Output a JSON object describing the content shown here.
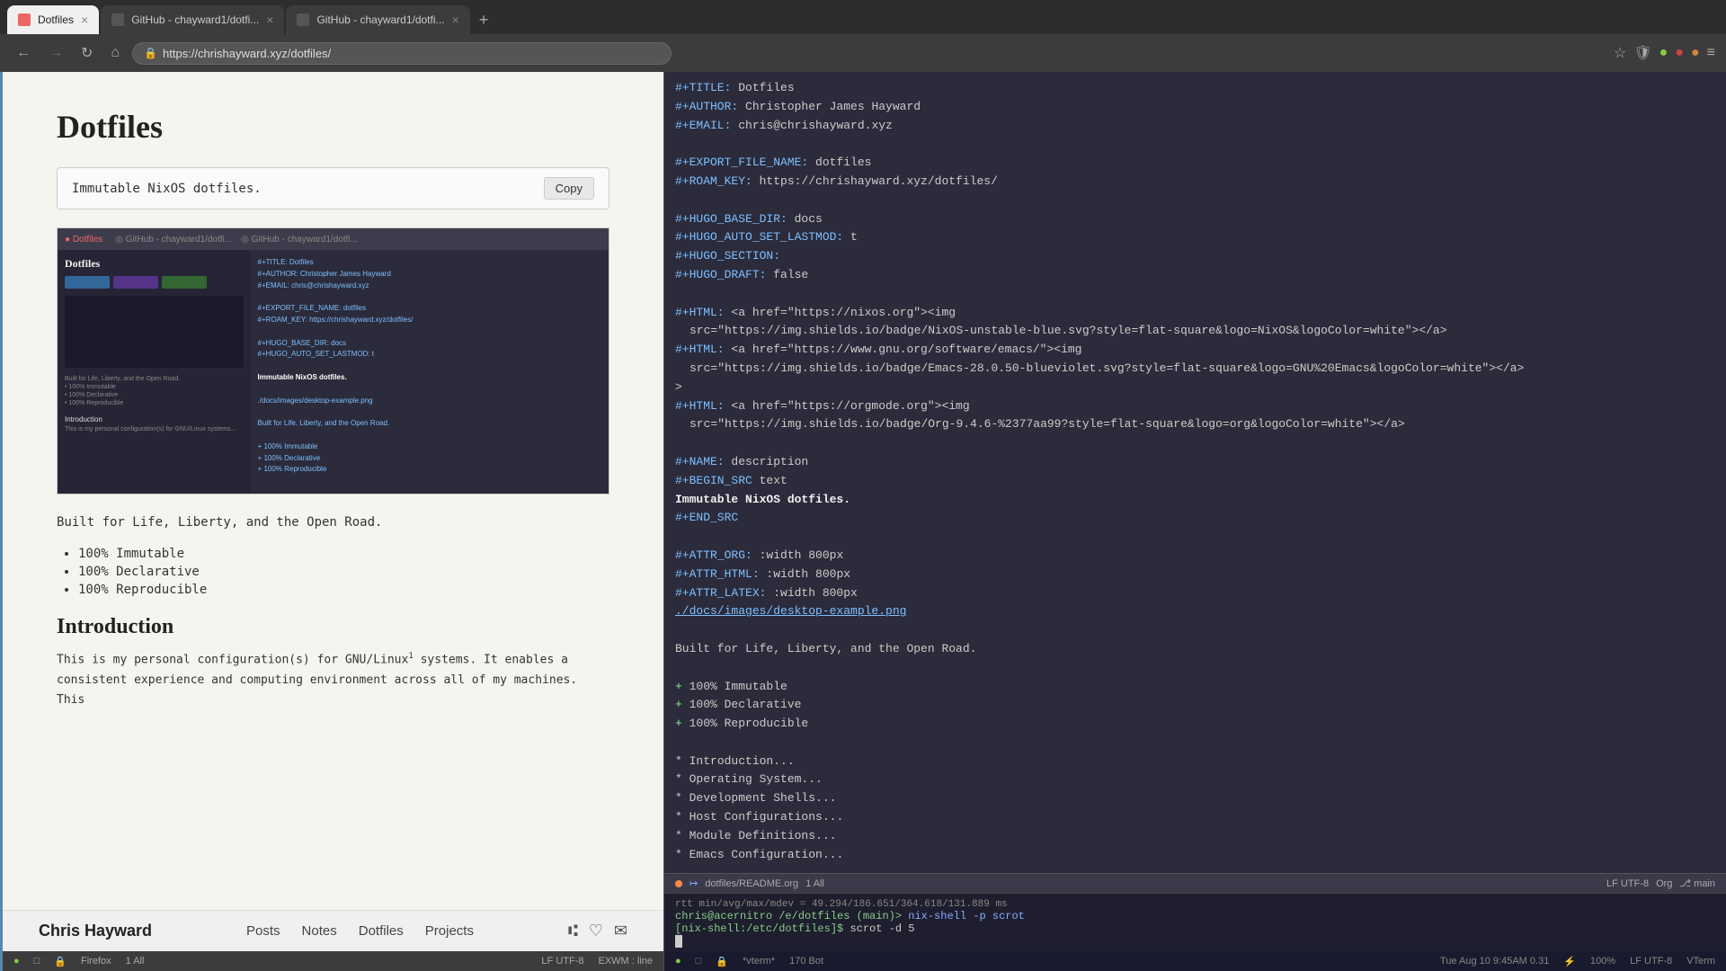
{
  "browser": {
    "tabs": [
      {
        "id": "tab1",
        "title": "Dotfiles",
        "favicon": "🦊",
        "active": true
      },
      {
        "id": "tab2",
        "title": "GitHub - chayward1/dotfi...",
        "favicon": "🐙",
        "active": false
      },
      {
        "id": "tab3",
        "title": "GitHub - chayward1/dotfi...",
        "favicon": "🐙",
        "active": false
      }
    ],
    "url": "https://chrishayward.xyz/dotfiles/",
    "nav_buttons": [
      "←",
      "→",
      "↻",
      "🏠"
    ]
  },
  "website": {
    "title": "Dotfiles",
    "description": "Immutable NixOS dotfiles.",
    "copy_label": "Copy",
    "body_text": "Built for Life, Liberty, and the Open Road.",
    "bullets": [
      "100% Immutable",
      "100% Declarative",
      "100% Reproducible"
    ],
    "intro_heading": "Introduction",
    "intro_text": "This is my personal configuration(s) for GNU/Linux",
    "intro_text2": " systems. It enables a consistent experience and computing environment across all of my machines. This"
  },
  "footer": {
    "name": "Chris Hayward",
    "nav_items": [
      "Posts",
      "Notes",
      "Dotfiles",
      "Projects"
    ]
  },
  "status_bar_browser": {
    "encoding": "LF UTF-8",
    "mode": "EXWM : line",
    "left_items": [
      "●",
      "□",
      "🔒",
      "Firefox",
      "1 All"
    ]
  },
  "editor": {
    "lines": [
      {
        "type": "keyword",
        "key": "#+TITLE:",
        "value": " Dotfiles"
      },
      {
        "type": "keyword",
        "key": "#+AUTHOR:",
        "value": " Christopher James Hayward"
      },
      {
        "type": "keyword",
        "key": "#+EMAIL:",
        "value": " chris@chrishayward.xyz"
      },
      {
        "type": "blank"
      },
      {
        "type": "keyword",
        "key": "#+EXPORT_FILE_NAME:",
        "value": " dotfiles"
      },
      {
        "type": "keyword",
        "key": "#+ROAM_KEY:",
        "value": " https://chrishayward.xyz/dotfiles/"
      },
      {
        "type": "blank"
      },
      {
        "type": "keyword",
        "key": "#+HUGO_BASE_DIR:",
        "value": " docs"
      },
      {
        "type": "keyword",
        "key": "#+HUGO_AUTO_SET_LASTMOD:",
        "value": " t"
      },
      {
        "type": "keyword",
        "key": "#+HUGO_SECTION:",
        "value": ""
      },
      {
        "type": "keyword",
        "key": "#+HUGO_DRAFT:",
        "value": " false"
      },
      {
        "type": "blank"
      },
      {
        "type": "html",
        "content": "#+HTML: <a href=\"https://nixos.org\"><img"
      },
      {
        "type": "html",
        "content": "src=\"https://img.shields.io/badge/NixOS-unstable-blue.svg?style=flat-square&logo=NixOS&logoColor=white\"></a>"
      },
      {
        "type": "html",
        "content": "#+HTML: <a href=\"https://www.gnu.org/software/emacs/\"><img"
      },
      {
        "type": "html",
        "content": "src=\"https://img.shields.io/badge/Emacs-28.0.50-blueviolet.svg?style=flat-square&logo=GNU%20Emacs&logoColor=white\"></a>"
      },
      {
        "type": "html",
        "content": ">"
      },
      {
        "type": "html",
        "content": "#+HTML: <a href=\"https://orgmode.org\"><img"
      },
      {
        "type": "html",
        "content": "src=\"https://img.shields.io/badge/Org-9.4.6-%2377aa99?style=flat-square&logo=org&logoColor=white\"></a>"
      },
      {
        "type": "blank"
      },
      {
        "type": "keyword",
        "key": "#+NAME:",
        "value": " description"
      },
      {
        "type": "keyword",
        "key": "#+BEGIN_SRC",
        "value": " text"
      },
      {
        "type": "bold",
        "content": "Immutable NixOS dotfiles."
      },
      {
        "type": "keyword",
        "key": "#+END_SRC",
        "value": ""
      },
      {
        "type": "blank"
      },
      {
        "type": "keyword",
        "key": "#+ATTR_ORG:",
        "value": " :width 800px"
      },
      {
        "type": "keyword",
        "key": "#+ATTR_HTML:",
        "value": " :width 800px"
      },
      {
        "type": "keyword",
        "key": "#+ATTR_LATEX:",
        "value": " :width 800px"
      },
      {
        "type": "link",
        "content": "./docs/images/desktop-example.png"
      },
      {
        "type": "blank"
      },
      {
        "type": "text",
        "content": "Built for Life, Liberty, and the Open Road."
      },
      {
        "type": "blank"
      },
      {
        "type": "list-plus",
        "content": "100% Immutable"
      },
      {
        "type": "list-plus",
        "content": "100% Declarative"
      },
      {
        "type": "list-plus",
        "content": "100% Reproducible"
      },
      {
        "type": "blank"
      },
      {
        "type": "list-star",
        "content": "Introduction..."
      },
      {
        "type": "list-star",
        "content": "Operating System..."
      },
      {
        "type": "list-star",
        "content": "Development Shells..."
      },
      {
        "type": "list-star",
        "content": "Host Configurations..."
      },
      {
        "type": "list-star",
        "content": "Module Definitions..."
      },
      {
        "type": "list-star",
        "content": "Emacs Configuration..."
      }
    ]
  },
  "editor_status": {
    "filename": "dotfiles/README.org",
    "position": "1 All",
    "encoding": "LF UTF-8",
    "mode": "Org",
    "branch": "main"
  },
  "terminal": {
    "rtt_line": "rtt min/avg/max/mdev = 49.294/186.651/364.618/131.889 ms",
    "prompt_line": "chris@acernitro /e/dotfiles (main)>",
    "highlight_cmd": "nix-shell -p scrot",
    "nix_prompt": "[nix-shell:/etc/dotfiles]$",
    "nix_cmd": "scrot -d 5"
  },
  "bottom_bar": {
    "left": [
      "●",
      "□",
      "🔒",
      "*vterm*",
      "170 Bot"
    ],
    "right": "Tue Aug 10 9:45AM 0.31",
    "battery": "100%",
    "encoding": "LF UTF-8",
    "term": "VTerm"
  }
}
